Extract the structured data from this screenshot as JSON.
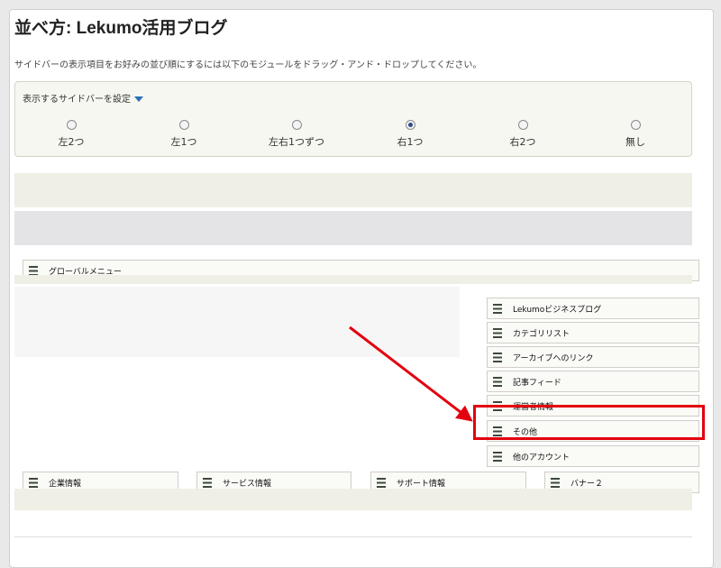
{
  "page": {
    "title": "並べ方: Lekumo活用ブログ",
    "description": "サイドバーの表示項目をお好みの並び順にするには以下のモジュールをドラッグ・アンド・ドロップしてください。"
  },
  "sidebar_setting": {
    "label": "表示するサイドバーを設定",
    "options": [
      {
        "label": "左2つ",
        "selected": false
      },
      {
        "label": "左1つ",
        "selected": false
      },
      {
        "label": "左右1つずつ",
        "selected": false
      },
      {
        "label": "右1つ",
        "selected": true
      },
      {
        "label": "右2つ",
        "selected": false
      },
      {
        "label": "無し",
        "selected": false
      }
    ]
  },
  "modules": {
    "global_menu": "グローバルメニュー",
    "sidebar": [
      "Lekumoビジネスブログ",
      "カテゴリリスト",
      "アーカイブへのリンク",
      "記事フィード",
      "運営者情報",
      "その他",
      "他のアカウント"
    ],
    "footer": [
      "企業情報",
      "サービス情報",
      "サポート情報",
      "バナー２"
    ]
  },
  "annotation": {
    "color": "#e3000f"
  }
}
